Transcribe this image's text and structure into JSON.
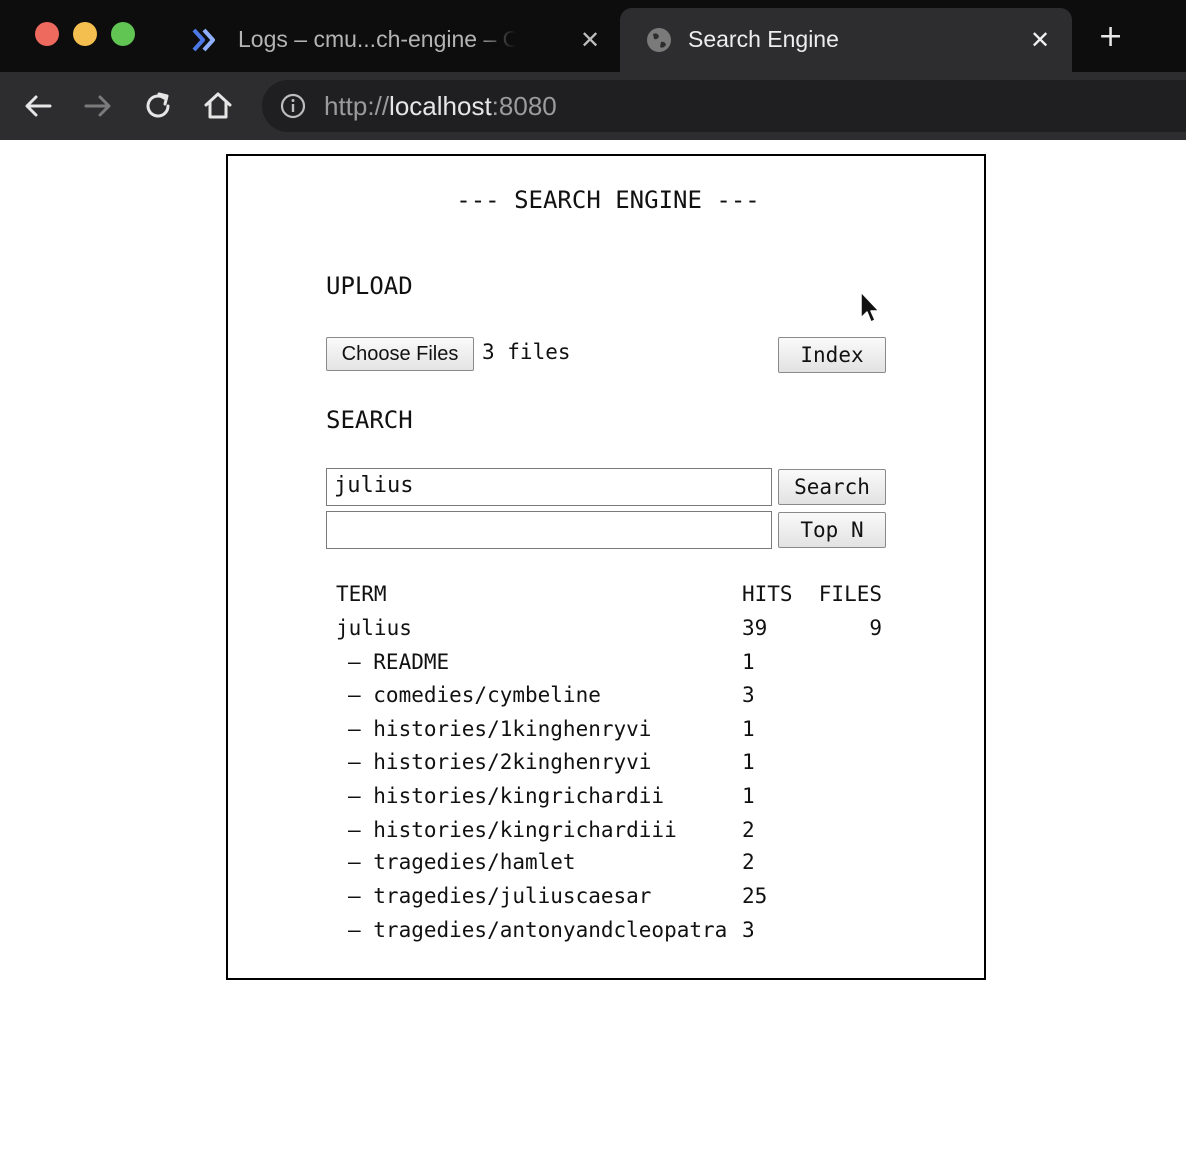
{
  "browser": {
    "tabs": [
      {
        "title": "Logs – cmu...ch-engine – Cloud",
        "active": false,
        "icon": "cloud-logging-icon"
      },
      {
        "title": "Search Engine",
        "active": true,
        "icon": "globe-icon"
      }
    ],
    "url": {
      "scheme": "http://",
      "host": "localhost",
      "port": ":8080"
    }
  },
  "page": {
    "heading": "--- SEARCH ENGINE ---",
    "upload": {
      "heading": "UPLOAD",
      "choose_files_label": "Choose Files",
      "files_selected": "3 files",
      "index_label": "Index"
    },
    "search": {
      "heading": "SEARCH",
      "query_value": "julius",
      "search_label": "Search",
      "topn_value": "",
      "topn_label": "Top N"
    },
    "results": {
      "headers": {
        "term": "TERM",
        "hits": "HITS",
        "files": "FILES"
      },
      "summary": {
        "term": "julius",
        "hits": "39",
        "files": "9"
      },
      "rows": [
        {
          "term": "– README",
          "hits": "1"
        },
        {
          "term": "– comedies/cymbeline",
          "hits": "3"
        },
        {
          "term": "– histories/1kinghenryvi",
          "hits": "1"
        },
        {
          "term": "– histories/2kinghenryvi",
          "hits": "1"
        },
        {
          "term": "– histories/kingrichardii",
          "hits": "1"
        },
        {
          "term": "– histories/kingrichardiii",
          "hits": "2"
        },
        {
          "term": "– tragedies/hamlet",
          "hits": "2"
        },
        {
          "term": "– tragedies/juliuscaesar",
          "hits": "25"
        },
        {
          "term": "– tragedies/antonyandcleopatra",
          "hits": "3"
        }
      ]
    }
  },
  "colors": {
    "tabbar_bg": "#0d0d0d",
    "toolbar_bg": "#2d2d2f",
    "omnibox_bg": "#1f1f21",
    "close_red": "#ee6a5e",
    "minimize_yellow": "#f5bf4f",
    "zoom_green": "#61c554"
  }
}
